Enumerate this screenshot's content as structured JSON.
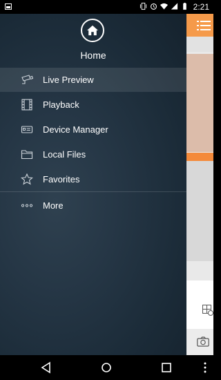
{
  "status_bar": {
    "time": "2:21",
    "icons": [
      "image-icon",
      "vibrate-icon",
      "alarm-icon",
      "wifi-icon",
      "signal-icon",
      "battery-icon"
    ]
  },
  "drawer": {
    "header": {
      "icon": "home-icon",
      "title": "Home"
    },
    "items": [
      {
        "label": "Live Preview",
        "icon": "cctv-camera-icon",
        "active": true
      },
      {
        "label": "Playback",
        "icon": "film-icon",
        "active": false
      },
      {
        "label": "Device Manager",
        "icon": "device-icon",
        "active": false
      },
      {
        "label": "Local Files",
        "icon": "folder-icon",
        "active": false
      },
      {
        "label": "Favorites",
        "icon": "star-icon",
        "active": false
      },
      {
        "label": "More",
        "icon": "more-icon",
        "active": false
      }
    ]
  },
  "background_app": {
    "accent_color": "#f59a4a",
    "icons": [
      "list-menu-icon",
      "layout-icon",
      "camera-icon"
    ]
  },
  "nav_bar": {
    "icons": [
      "back-icon",
      "home-circle-icon",
      "recents-icon",
      "overflow-icon"
    ]
  }
}
